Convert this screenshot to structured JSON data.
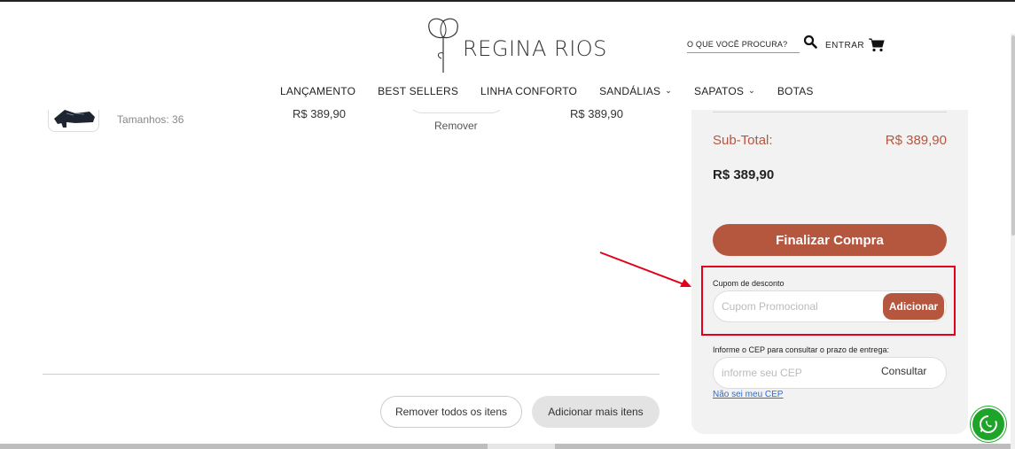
{
  "brand": {
    "name": "REGINA RIOS"
  },
  "header": {
    "search_placeholder": "O QUE VOCÊ PROCURA?",
    "login_label": "ENTRAR",
    "nav": [
      {
        "label": "LANÇAMENTO",
        "dropdown": false
      },
      {
        "label": "BEST SELLERS",
        "dropdown": false
      },
      {
        "label": "LINHA CONFORTO",
        "dropdown": false
      },
      {
        "label": "SANDÁLIAS",
        "dropdown": true
      },
      {
        "label": "SAPATOS",
        "dropdown": true
      },
      {
        "label": "BOTAS",
        "dropdown": false
      }
    ]
  },
  "cart": {
    "item": {
      "sizes_label": "Tamanhos: 36",
      "unit_price": "R$ 389,90",
      "remove_label": "Remover",
      "total_price": "R$ 389,90"
    },
    "remove_all_label": "Remover todos os itens",
    "add_more_label": "Adicionar mais itens"
  },
  "summary": {
    "subtotal_label": "Sub-Total:",
    "subtotal_value": "R$ 389,90",
    "total_value": "R$ 389,90",
    "checkout_label": "Finalizar Compra",
    "coupon_label": "Cupom de desconto",
    "coupon_placeholder": "Cupom Promocional",
    "coupon_button": "Adicionar",
    "cep_label": "Informe o CEP para consultar o prazo de entrega:",
    "cep_placeholder": "informe seu CEP",
    "cep_button": "Consultar",
    "cep_unknown_link": "Não sei meu CEP"
  },
  "colors": {
    "accent": "#b5563f",
    "highlight": "#e3001b",
    "whatsapp": "#1fa42a",
    "panel": "#f2f2f2"
  },
  "icons": [
    "logo-flower-icon",
    "search-icon",
    "cart-icon",
    "chevron-down-icon",
    "annotation-arrow-icon",
    "whatsapp-icon"
  ]
}
